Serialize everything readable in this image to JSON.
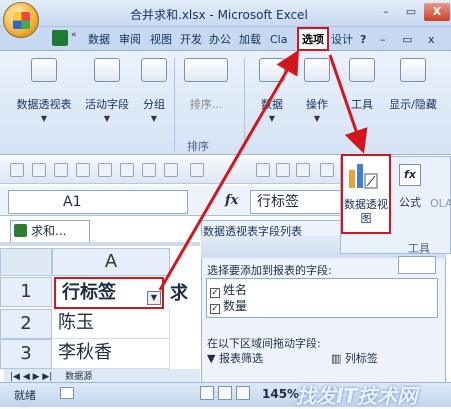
{
  "window": {
    "title": "合并求和.xlsx - Microsoft Excel",
    "close": "X",
    "min": "–",
    "max": "▭"
  },
  "tabs": [
    {
      "label": "数据"
    },
    {
      "label": "审阅"
    },
    {
      "label": "视图"
    },
    {
      "label": "开发"
    },
    {
      "label": "办公"
    },
    {
      "label": "加载"
    },
    {
      "label": "Cla"
    },
    {
      "label": "选项"
    },
    {
      "label": "设计"
    }
  ],
  "ribbon": {
    "buttons": [
      {
        "label": "数据透视表"
      },
      {
        "label": "活动字段"
      },
      {
        "label": "分组"
      },
      {
        "label": "排序..."
      },
      {
        "label": "数据"
      },
      {
        "label": "操作"
      },
      {
        "label": "工具"
      },
      {
        "label": "显示/隐藏"
      }
    ],
    "sort_group": "排序"
  },
  "popout": {
    "pivot_chart_label": "数据透视图",
    "formula_label": "公式",
    "ola_label": "OLA",
    "tools_group": "工具"
  },
  "formula_bar": {
    "name_box": "A1",
    "fx": "fx",
    "value": "行标签"
  },
  "sheet": {
    "tab_label": "求和...",
    "column": "A",
    "rows": [
      {
        "num": "1",
        "value": "行标签"
      },
      {
        "num": "2",
        "value": "陈玉"
      },
      {
        "num": "3",
        "value": "李秋香"
      }
    ],
    "b1_fragment": "求",
    "nav_label": "数据源"
  },
  "pivot_panel": {
    "title": "数据透视表字段列表",
    "prompt": "选择要添加到报表的字段:",
    "fields": [
      {
        "label": "姓名",
        "checked": "✓"
      },
      {
        "label": "数量",
        "checked": "✓"
      }
    ],
    "drag_prompt": "在以下区域间拖动字段:",
    "report_filter": "报表筛选",
    "col_labels": "列标签"
  },
  "status": {
    "ready": "就绪",
    "zoom": "145%"
  },
  "watermark": "找发IT技术网"
}
